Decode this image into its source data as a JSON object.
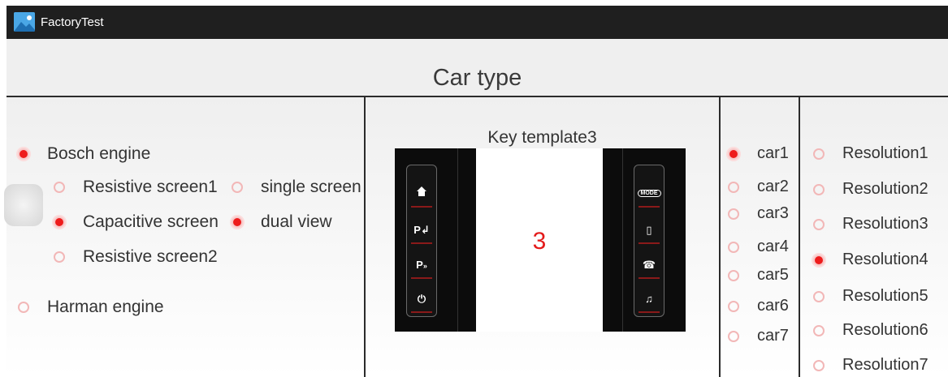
{
  "app": {
    "title": "FactoryTest"
  },
  "header": {
    "title": "Car type"
  },
  "engine": {
    "bosch": {
      "label": "Bosch engine",
      "selected": true
    },
    "screens": [
      {
        "label": "Resistive screen1",
        "selected": false
      },
      {
        "label": "Capacitive screen",
        "selected": true
      },
      {
        "label": "Resistive screen2",
        "selected": false
      }
    ],
    "views": [
      {
        "label": "single screen",
        "selected": false
      },
      {
        "label": "dual view",
        "selected": true
      }
    ],
    "harman": {
      "label": "Harman engine",
      "selected": false
    }
  },
  "key_template": {
    "title": "Key template3",
    "number": "3",
    "left_keys": [
      "home-icon",
      "park-assist-icon",
      "park-sensor-icon",
      "power-icon"
    ],
    "right_keys": [
      "mode-icon",
      "media-icon",
      "phone-icon",
      "music-icon"
    ],
    "mode_label": "MODE",
    "park_label": "P"
  },
  "cars": [
    {
      "label": "car1",
      "selected": true
    },
    {
      "label": "car2",
      "selected": false
    },
    {
      "label": "car3",
      "selected": false
    },
    {
      "label": "car4",
      "selected": false
    },
    {
      "label": "car5",
      "selected": false
    },
    {
      "label": "car6",
      "selected": false
    },
    {
      "label": "car7",
      "selected": false
    }
  ],
  "resolutions": [
    {
      "label": "Resolution1",
      "selected": false
    },
    {
      "label": "Resolution2",
      "selected": false
    },
    {
      "label": "Resolution3",
      "selected": false
    },
    {
      "label": "Resolution4",
      "selected": true
    },
    {
      "label": "Resolution5",
      "selected": false
    },
    {
      "label": "Resolution6",
      "selected": false
    },
    {
      "label": "Resolution7",
      "selected": false
    }
  ],
  "colors": {
    "accent": "#ee1c1c",
    "bar": "#1f1f1f",
    "divider": "#2b2b2b"
  }
}
